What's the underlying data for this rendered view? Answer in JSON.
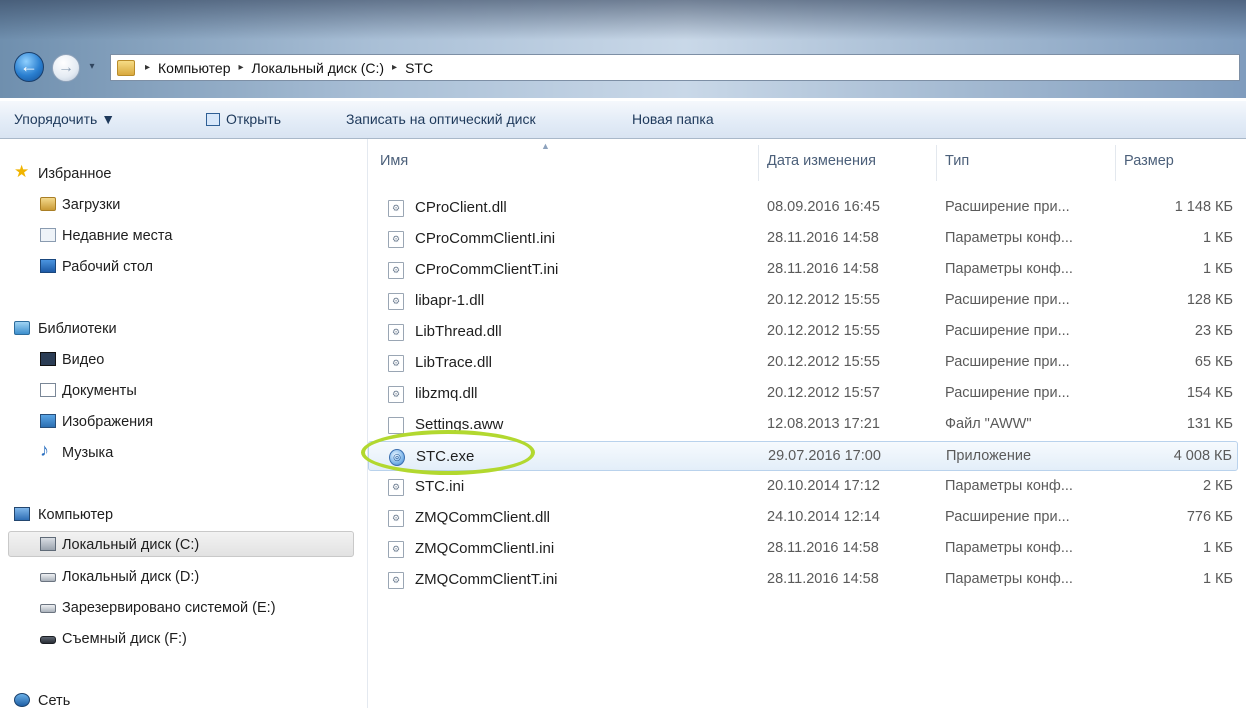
{
  "navigation": {
    "back_glyph": "←",
    "forward_glyph": "→",
    "history_glyph": "▾",
    "breadcrumb_separator": "▸",
    "breadcrumb": [
      "Компьютер",
      "Локальный диск (C:)",
      "STC"
    ]
  },
  "toolbar": {
    "organize_label": "Упорядочить ▼",
    "open_label": "Открыть",
    "burn_label": "Записать на оптический диск",
    "new_folder_label": "Новая папка"
  },
  "sidebar": {
    "favorites": {
      "label": "Избранное",
      "icon": "star-icon",
      "items": [
        {
          "label": "Загрузки",
          "icon": "downloads-folder-icon"
        },
        {
          "label": "Недавние места",
          "icon": "recent-places-icon"
        },
        {
          "label": "Рабочий стол",
          "icon": "desktop-icon"
        }
      ]
    },
    "libraries": {
      "label": "Библиотеки",
      "icon": "libraries-icon",
      "items": [
        {
          "label": "Видео",
          "icon": "video-icon"
        },
        {
          "label": "Документы",
          "icon": "documents-icon"
        },
        {
          "label": "Изображения",
          "icon": "images-icon"
        },
        {
          "label": "Музыка",
          "icon": "music-icon"
        }
      ]
    },
    "computer": {
      "label": "Компьютер",
      "icon": "computer-icon",
      "items": [
        {
          "label": "Локальный диск (C:)",
          "icon": "system-drive-icon",
          "selected": true
        },
        {
          "label": "Локальный диск (D:)",
          "icon": "hard-drive-icon"
        },
        {
          "label": "Зарезервировано системой (E:)",
          "icon": "hard-drive-icon"
        },
        {
          "label": "Съемный диск (F:)",
          "icon": "removable-drive-icon"
        }
      ]
    },
    "network": {
      "label": "Сеть",
      "icon": "network-icon"
    }
  },
  "columns": {
    "name": "Имя",
    "date": "Дата изменения",
    "type": "Тип",
    "size": "Размер",
    "sort_glyph": "▲"
  },
  "files": [
    {
      "name": "CProClient.dll",
      "date": "08.09.2016 16:45",
      "type": "Расширение при...",
      "size": "1 148 КБ",
      "icon": "dll-file-icon"
    },
    {
      "name": "CProCommClientI.ini",
      "date": "28.11.2016 14:58",
      "type": "Параметры конф...",
      "size": "1 КБ",
      "icon": "config-file-icon"
    },
    {
      "name": "CProCommClientT.ini",
      "date": "28.11.2016 14:58",
      "type": "Параметры конф...",
      "size": "1 КБ",
      "icon": "config-file-icon"
    },
    {
      "name": "libapr-1.dll",
      "date": "20.12.2012 15:55",
      "type": "Расширение при...",
      "size": "128 КБ",
      "icon": "dll-file-icon"
    },
    {
      "name": "LibThread.dll",
      "date": "20.12.2012 15:55",
      "type": "Расширение при...",
      "size": "23 КБ",
      "icon": "dll-file-icon"
    },
    {
      "name": "LibTrace.dll",
      "date": "20.12.2012 15:55",
      "type": "Расширение при...",
      "size": "65 КБ",
      "icon": "dll-file-icon"
    },
    {
      "name": "libzmq.dll",
      "date": "20.12.2012 15:57",
      "type": "Расширение при...",
      "size": "154 КБ",
      "icon": "dll-file-icon"
    },
    {
      "name": "Settings.aww",
      "date": "12.08.2013 17:21",
      "type": "Файл \"AWW\"",
      "size": "131 КБ",
      "icon": "generic-file-icon"
    },
    {
      "name": "STC.exe",
      "date": "29.07.2016 17:00",
      "type": "Приложение",
      "size": "4 008 КБ",
      "icon": "application-icon",
      "selected": true
    },
    {
      "name": "STC.ini",
      "date": "20.10.2014 17:12",
      "type": "Параметры конф...",
      "size": "2 КБ",
      "icon": "config-file-icon"
    },
    {
      "name": "ZMQCommClient.dll",
      "date": "24.10.2014 12:14",
      "type": "Расширение при...",
      "size": "776 КБ",
      "icon": "dll-file-icon"
    },
    {
      "name": "ZMQCommClientI.ini",
      "date": "28.11.2016 14:58",
      "type": "Параметры конф...",
      "size": "1 КБ",
      "icon": "config-file-icon"
    },
    {
      "name": "ZMQCommClientT.ini",
      "date": "28.11.2016 14:58",
      "type": "Параметры конф...",
      "size": "1 КБ",
      "icon": "config-file-icon"
    }
  ],
  "file_icon_glyphs": {
    "dll-file-icon": "⚙",
    "config-file-icon": "⚙",
    "generic-file-icon": "",
    "application-icon": "◎"
  },
  "colors": {
    "highlight_ellipse": "#b2d82f",
    "selection_fill": "#e3eef9",
    "selection_border": "#b9d2ec",
    "link_text": "#1e395b"
  }
}
